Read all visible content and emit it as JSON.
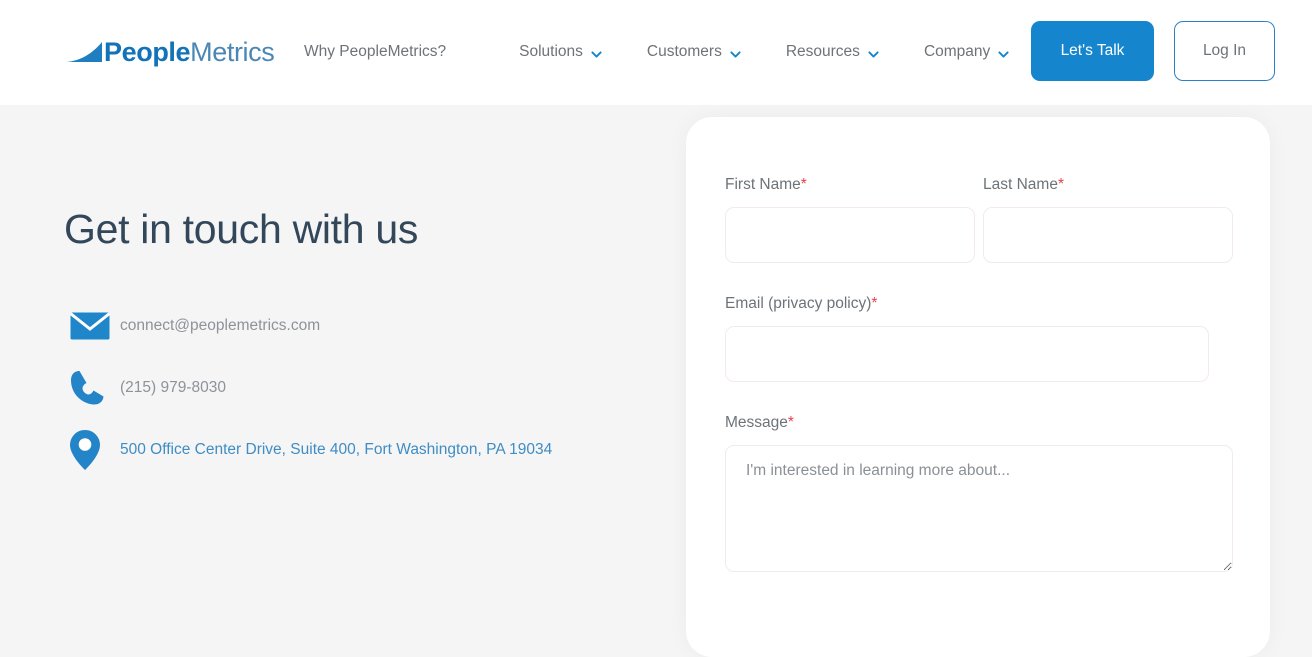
{
  "brand": {
    "name_bold": "People",
    "name_light": "Metrics",
    "logo_icon": "peoplemetrics-swoosh-icon",
    "primary_color": "#1273b8",
    "accent_color": "#1586cd"
  },
  "header": {
    "nav": [
      {
        "label": "Why PeopleMetrics?",
        "has_dropdown": false,
        "icon": ""
      },
      {
        "label": "Solutions",
        "has_dropdown": true,
        "icon": "chevron-down-icon"
      },
      {
        "label": "Customers",
        "has_dropdown": true,
        "icon": "chevron-down-icon"
      },
      {
        "label": "Resources",
        "has_dropdown": true,
        "icon": "chevron-down-icon"
      },
      {
        "label": "Company",
        "has_dropdown": true,
        "icon": "chevron-down-icon"
      }
    ],
    "cta_primary": "Let's Talk",
    "cta_secondary": "Log In"
  },
  "main": {
    "title": "Get in touch with us",
    "contacts": [
      {
        "icon": "envelope-icon",
        "text": "connect@peoplemetrics.com",
        "style": "muted"
      },
      {
        "icon": "phone-icon",
        "text": "(215) 979-8030",
        "style": "muted"
      },
      {
        "icon": "map-pin-icon",
        "text": "500 Office Center Drive, Suite 400, Fort Washington, PA 19034",
        "style": "link"
      }
    ]
  },
  "form": {
    "first_name": {
      "label": "First Name",
      "required_mark": "*",
      "value": "",
      "placeholder": ""
    },
    "last_name": {
      "label": "Last Name",
      "required_mark": "*",
      "value": "",
      "placeholder": ""
    },
    "email": {
      "label": "Email (privacy policy)",
      "required_mark": "*",
      "value": "",
      "placeholder": ""
    },
    "message": {
      "label": "Message",
      "required_mark": "*",
      "value": "",
      "placeholder": "I'm interested in learning more about..."
    }
  },
  "colors": {
    "page_background": "#f5f5f5",
    "card_background": "#ffffff",
    "heading": "#33475b",
    "muted_text": "#8d9399",
    "link_text": "#3f8dc4",
    "required_asterisk": "#e8414a",
    "input_border": "#f3eaec"
  }
}
